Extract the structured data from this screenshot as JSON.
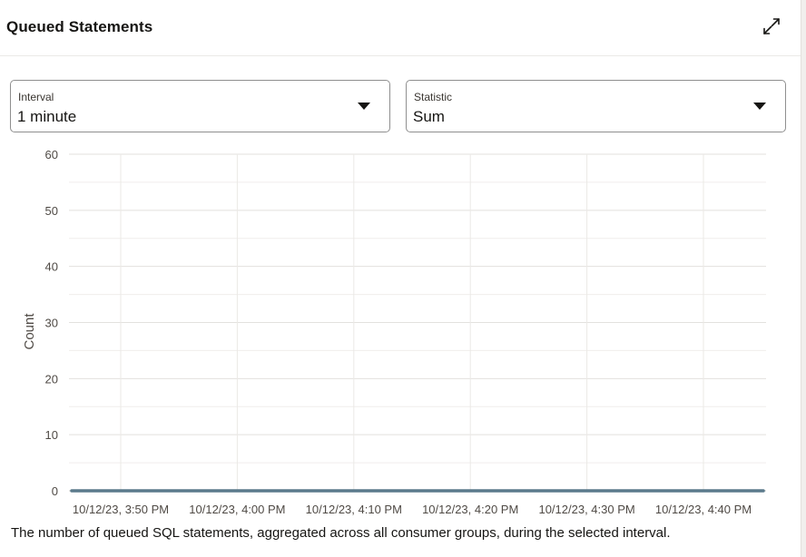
{
  "title": "Queued Statements",
  "icons": {
    "expand": "expand-icon",
    "caret": "chevron-down-icon"
  },
  "interval": {
    "label": "Interval",
    "value": "1 minute"
  },
  "statistic": {
    "label": "Statistic",
    "value": "Sum"
  },
  "chart_data": {
    "type": "line",
    "ylabel": "Count",
    "xlabel": "",
    "ylim": [
      0,
      60
    ],
    "y_ticks": [
      "0",
      "10",
      "20",
      "30",
      "40",
      "50",
      "60"
    ],
    "x_tick_labels": [
      "10/12/23, 3:50 PM",
      "10/12/23, 4:00 PM",
      "10/12/23, 4:10 PM",
      "10/12/23, 4:20 PM",
      "10/12/23, 4:30 PM",
      "10/12/23, 4:40 PM"
    ],
    "grid": true,
    "series": [
      {
        "values": [
          0,
          0,
          0,
          0,
          0,
          0
        ],
        "color": "#5b7a8c"
      }
    ]
  },
  "caption": "The number of queued SQL statements, aggregated across all consumer groups, during the selected interval."
}
